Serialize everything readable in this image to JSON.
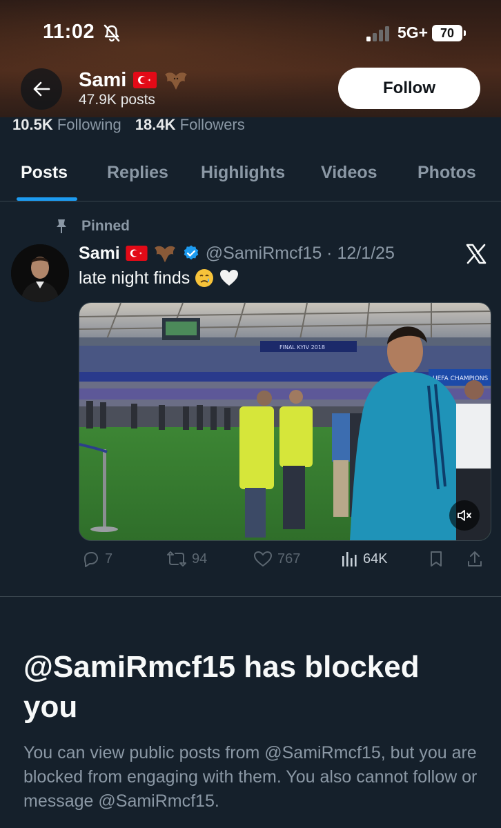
{
  "status_bar": {
    "time": "11:02",
    "network": "5G+",
    "battery": "70"
  },
  "header": {
    "name": "Sami",
    "posts_count": "47.9K posts",
    "follow_label": "Follow"
  },
  "stats": {
    "following_count": "10.5K",
    "following_label": "Following",
    "followers_count": "18.4K",
    "followers_label": "Followers"
  },
  "tabs": [
    {
      "label": "Posts",
      "active": true
    },
    {
      "label": "Replies"
    },
    {
      "label": "Highlights"
    },
    {
      "label": "Videos"
    },
    {
      "label": "Photos"
    }
  ],
  "post": {
    "pinned_label": "Pinned",
    "author_name": "Sami",
    "handle_date": "@SamiRmcf15 · 12/1/25",
    "text": "late night finds",
    "media_signage": [
      "FINAL KYIV 2018",
      "UEFA CHAMPIONS LEAG"
    ],
    "actions": {
      "replies": "7",
      "reposts": "94",
      "likes": "767",
      "views": "64K"
    }
  },
  "blocked": {
    "title": "@SamiRmcf15 has blocked you",
    "description": "You can view public posts from @SamiRmcf15, but you are blocked from engaging with them. You also cannot follow or message @SamiRmcf15."
  },
  "colors": {
    "accent": "#1d9bf0",
    "background": "#15202b",
    "muted": "#8b98a5"
  },
  "icons": [
    "back-arrow-icon",
    "bell-slash-icon",
    "signal-icon",
    "pin-icon",
    "verified-icon",
    "x-logo-icon",
    "mute-icon",
    "reply-icon",
    "repost-icon",
    "like-icon",
    "views-icon",
    "bookmark-icon",
    "share-icon"
  ]
}
